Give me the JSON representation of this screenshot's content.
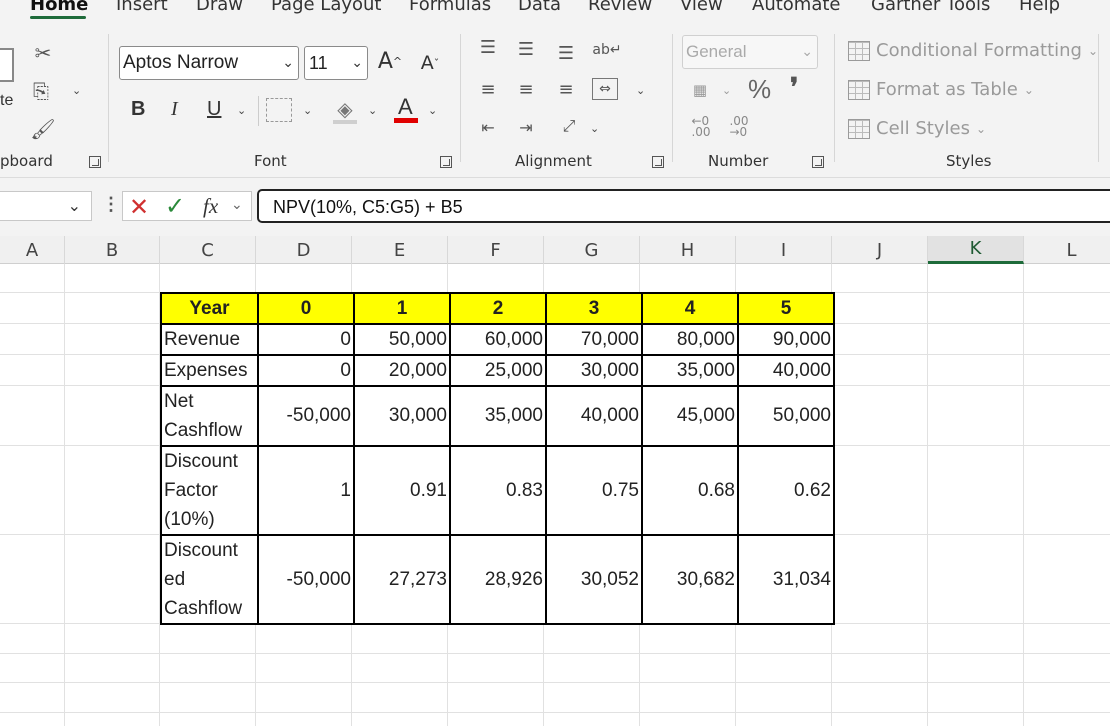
{
  "ribbon": {
    "tabs": [
      "Home",
      "Insert",
      "Draw",
      "Page Layout",
      "Formulas",
      "Data",
      "Review",
      "View",
      "Automate",
      "Gartner Tools",
      "Help"
    ],
    "active_tab": "Home",
    "clipboard": {
      "paste_label": "te",
      "group_label": "pboard"
    },
    "font": {
      "family": "Aptos Narrow",
      "size": "11",
      "group_label": "Font",
      "bold": "B",
      "italic": "I",
      "underline": "U"
    },
    "alignment": {
      "group_label": "Alignment"
    },
    "number": {
      "format": "General",
      "percent": "%",
      "comma": "❜",
      "group_label": "Number"
    },
    "styles": {
      "conditional_formatting": "Conditional Formatting",
      "format_as_table": "Format as Table",
      "cell_styles": "Cell Styles",
      "group_label": "Styles"
    },
    "font_color_hex": "#e00000"
  },
  "formula_bar": {
    "fx": "fx",
    "formula": "NPV(10%, C5:G5) + B5"
  },
  "columns": [
    "A",
    "B",
    "C",
    "D",
    "E",
    "F",
    "G",
    "H",
    "I",
    "J",
    "K",
    "L"
  ],
  "active_column": "K",
  "table": {
    "header_color": "#ffff00",
    "headers": [
      "Year",
      "0",
      "1",
      "2",
      "3",
      "4",
      "5"
    ],
    "rows": [
      {
        "label": "Revenue",
        "values": [
          "0",
          "50,000",
          "60,000",
          "70,000",
          "80,000",
          "90,000"
        ]
      },
      {
        "label": "Expenses",
        "values": [
          "0",
          "20,000",
          "25,000",
          "30,000",
          "35,000",
          "40,000"
        ]
      },
      {
        "label": "Net\nCashflow",
        "values": [
          "-50,000",
          "30,000",
          "35,000",
          "40,000",
          "45,000",
          "50,000"
        ]
      },
      {
        "label": "Discount\nFactor\n(10%)",
        "values": [
          "1",
          "0.91",
          "0.83",
          "0.75",
          "0.68",
          "0.62"
        ]
      },
      {
        "label": "Discount\ned\nCashflow",
        "values": [
          "-50,000",
          "27,273",
          "28,926",
          "30,052",
          "30,682",
          "31,034"
        ]
      }
    ]
  }
}
